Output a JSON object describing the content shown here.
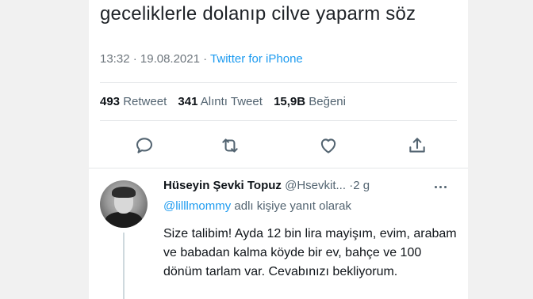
{
  "tweet": {
    "text": "geceliklerle dolanıp cilve yaparm söz",
    "time": "13:32",
    "date": "19.08.2021",
    "source": "Twitter for iPhone"
  },
  "stats": {
    "retweets_count": "493",
    "retweets_label": "Retweet",
    "quotes_count": "341",
    "quotes_label": "Alıntı Tweet",
    "likes_count": "15,9B",
    "likes_label": "Beğeni"
  },
  "actions": [
    "reply-icon",
    "retweet-icon",
    "like-icon",
    "share-icon"
  ],
  "reply": {
    "name": "Hüseyin Şevki Topuz",
    "handle": "@Hsevkit...",
    "time": "2 g",
    "mention": "@lilllmommy",
    "reply_to_suffix": "adlı kişiye yanıt olarak",
    "text": "Size talibim! Ayda 12 bin lira mayişım, evim, arabam ve babadan kalma köyde bir ev, bahçe ve 100 dönüm tarlam var. Cevabınızı bekliyorum."
  },
  "colors": {
    "link": "#1d9bf0",
    "muted": "#536471",
    "text": "#0f1419"
  }
}
